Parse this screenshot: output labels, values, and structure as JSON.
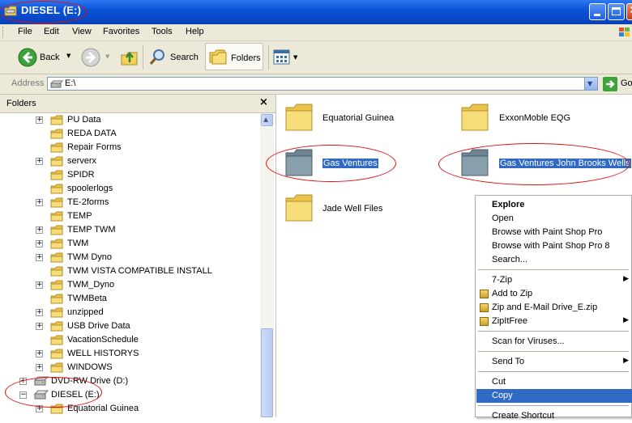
{
  "window": {
    "title": "DIESEL (E:)"
  },
  "menubar": {
    "items": [
      "File",
      "Edit",
      "View",
      "Favorites",
      "Tools",
      "Help"
    ]
  },
  "toolbar": {
    "back": "Back",
    "search": "Search",
    "folders": "Folders"
  },
  "address": {
    "label": "Address",
    "value": "E:\\",
    "go": "Go"
  },
  "folders_pane": {
    "title": "Folders",
    "items": [
      {
        "label": "PU Data",
        "expandable": true
      },
      {
        "label": "REDA DATA",
        "expandable": false
      },
      {
        "label": "Repair Forms",
        "expandable": false
      },
      {
        "label": "serverx",
        "expandable": true
      },
      {
        "label": "SPIDR",
        "expandable": false
      },
      {
        "label": "spoolerlogs",
        "expandable": false
      },
      {
        "label": "TE-2forms",
        "expandable": true
      },
      {
        "label": "TEMP",
        "expandable": false
      },
      {
        "label": "TEMP TWM",
        "expandable": true
      },
      {
        "label": "TWM",
        "expandable": true
      },
      {
        "label": "TWM Dyno",
        "expandable": true
      },
      {
        "label": "TWM VISTA COMPATIBLE INSTALL",
        "expandable": false
      },
      {
        "label": "TWM_Dyno",
        "expandable": true
      },
      {
        "label": "TWMBeta",
        "expandable": false
      },
      {
        "label": "unzipped",
        "expandable": true
      },
      {
        "label": "USB Drive Data",
        "expandable": true
      },
      {
        "label": "VacationSchedule",
        "expandable": false
      },
      {
        "label": "WELL HISTORYS",
        "expandable": true
      },
      {
        "label": "WINDOWS",
        "expandable": true
      }
    ],
    "drives": [
      {
        "label": "DVD-RW Drive (D:)"
      },
      {
        "label": "DIESEL (E:)"
      }
    ],
    "sub_items": [
      {
        "label": "Equatorial Guinea"
      }
    ]
  },
  "content": {
    "folders": [
      {
        "label": "Equatorial Guinea",
        "selected": false
      },
      {
        "label": "ExxonMoble EQG",
        "selected": false
      },
      {
        "label": "Gas Ventures",
        "selected": true
      },
      {
        "label": "Gas Ventures John Brooks Wells",
        "selected": true
      },
      {
        "label": "Jade Well Files",
        "selected": false
      }
    ]
  },
  "context_menu": {
    "items": [
      {
        "label": "Explore",
        "bold": true
      },
      {
        "label": "Open"
      },
      {
        "label": "Browse with Paint Shop Pro"
      },
      {
        "label": "Browse with Paint Shop Pro 8"
      },
      {
        "label": "Search..."
      },
      {
        "label": "7-Zip",
        "submenu": true
      },
      {
        "label": "Add to Zip",
        "icon": "zip-icon"
      },
      {
        "label": "Zip and E-Mail Drive_E.zip",
        "icon": "zip-mail-icon"
      },
      {
        "label": "ZipItFree",
        "icon": "zipitfree-icon",
        "submenu": true
      },
      {
        "label": "Scan for Viruses..."
      },
      {
        "label": "Send To",
        "submenu": true
      },
      {
        "label": "Cut"
      },
      {
        "label": "Copy",
        "highlighted": true
      },
      {
        "label": "Create Shortcut"
      }
    ]
  },
  "colors": {
    "selection": "#316ac5",
    "annotation": "#e01010",
    "titlebar": "#0a53d8"
  }
}
